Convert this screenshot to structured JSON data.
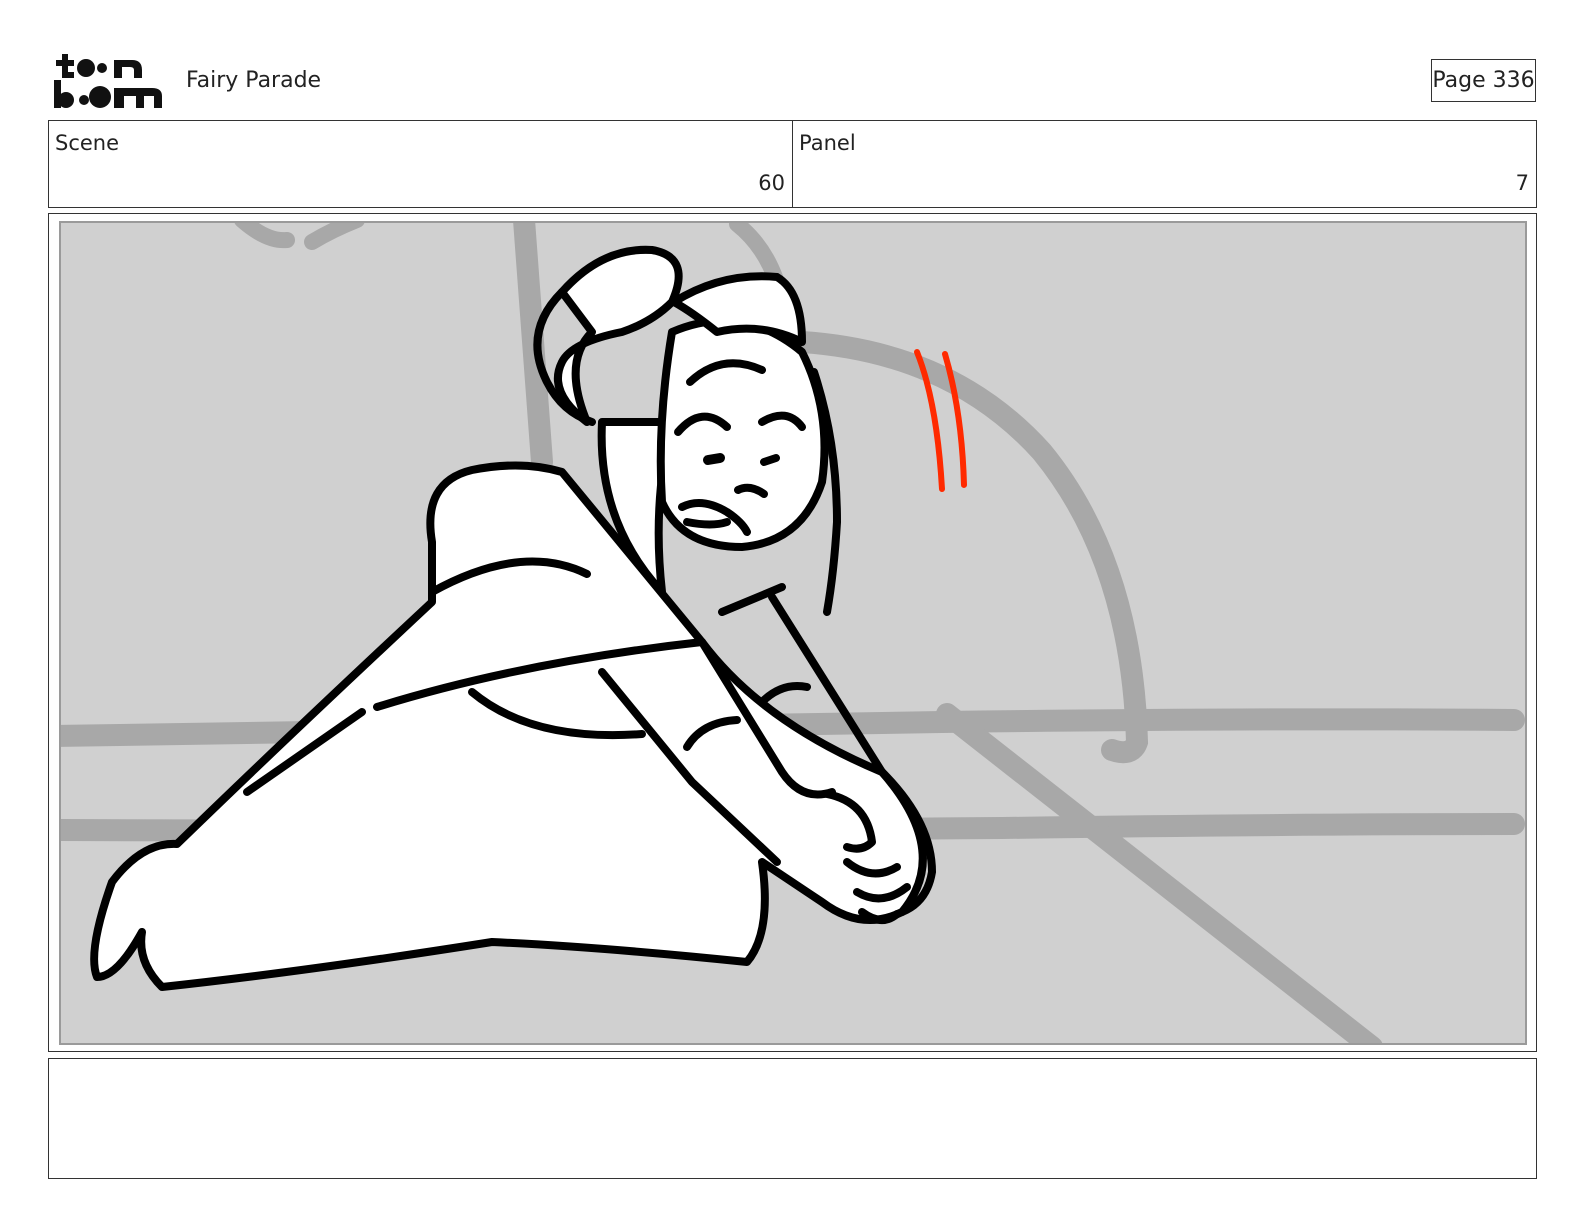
{
  "header": {
    "logo_text": "toon boom",
    "project_title": "Fairy Parade",
    "page_label": "Page 336"
  },
  "scene": {
    "label": "Scene",
    "value": "60"
  },
  "panel": {
    "label": "Panel",
    "value": "7"
  },
  "notes": {
    "text": ""
  },
  "colors": {
    "panel_background": "#d0d0d0",
    "background_lines": "#a8a8a8",
    "ink": "#000000",
    "motion_lines": "#ff2a00"
  },
  "drawing": {
    "icon": "storyboard-sketch-girl-kneeling"
  }
}
